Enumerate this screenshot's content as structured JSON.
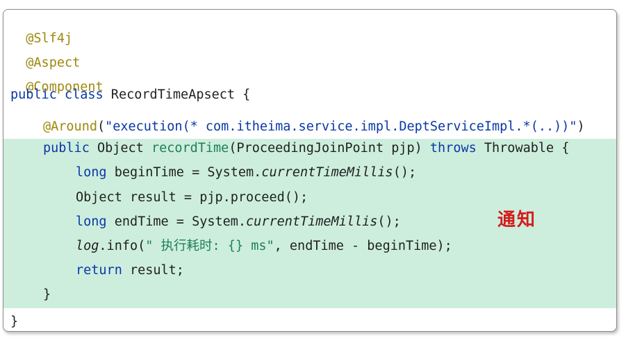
{
  "code": {
    "line1": {
      "annotation": "@Slf4j"
    },
    "line2": {
      "annotation": "@Aspect"
    },
    "line3": {
      "annotation": "@Component"
    },
    "line4": {
      "kw_public": "public",
      "kw_class": "class",
      "rest": " RecordTimeApsect {"
    },
    "line5": {
      "annotation": "@Around",
      "paren_open": "(",
      "string": "\"execution(* com.itheima.service.impl.DeptServiceImpl.*(..))\"",
      "paren_close": ")"
    },
    "line6": {
      "kw_public": "public",
      "type": " Object ",
      "method": "recordTime",
      "params": "(ProceedingJoinPoint pjp) ",
      "kw_throws": "throws",
      "rest": " Throwable {"
    },
    "line7": {
      "kw_long": "long",
      "mid": " beginTime = System.",
      "italic": "currentTimeMillis",
      "end": "();"
    },
    "line8": {
      "text": "Object result = pjp.proceed();"
    },
    "line9": {
      "kw_long": "long",
      "mid": " endTime = System.",
      "italic": "currentTimeMillis",
      "end": "();"
    },
    "line10": {
      "log": "log",
      "mid": ".info(",
      "string": "\" 执行耗时: {} ms\"",
      "rest": ", endTime - beginTime);"
    },
    "line11": {
      "kw_return": "return",
      "rest": " result;"
    },
    "line12": {
      "text": "}"
    },
    "line13": {
      "text": "}"
    }
  },
  "annotation_label": "通知",
  "colors": {
    "annotation": "#9e880d",
    "keyword": "#0a37a6",
    "method": "#1e7f55",
    "highlight": "#cdeedd",
    "label": "#d51c1c"
  }
}
